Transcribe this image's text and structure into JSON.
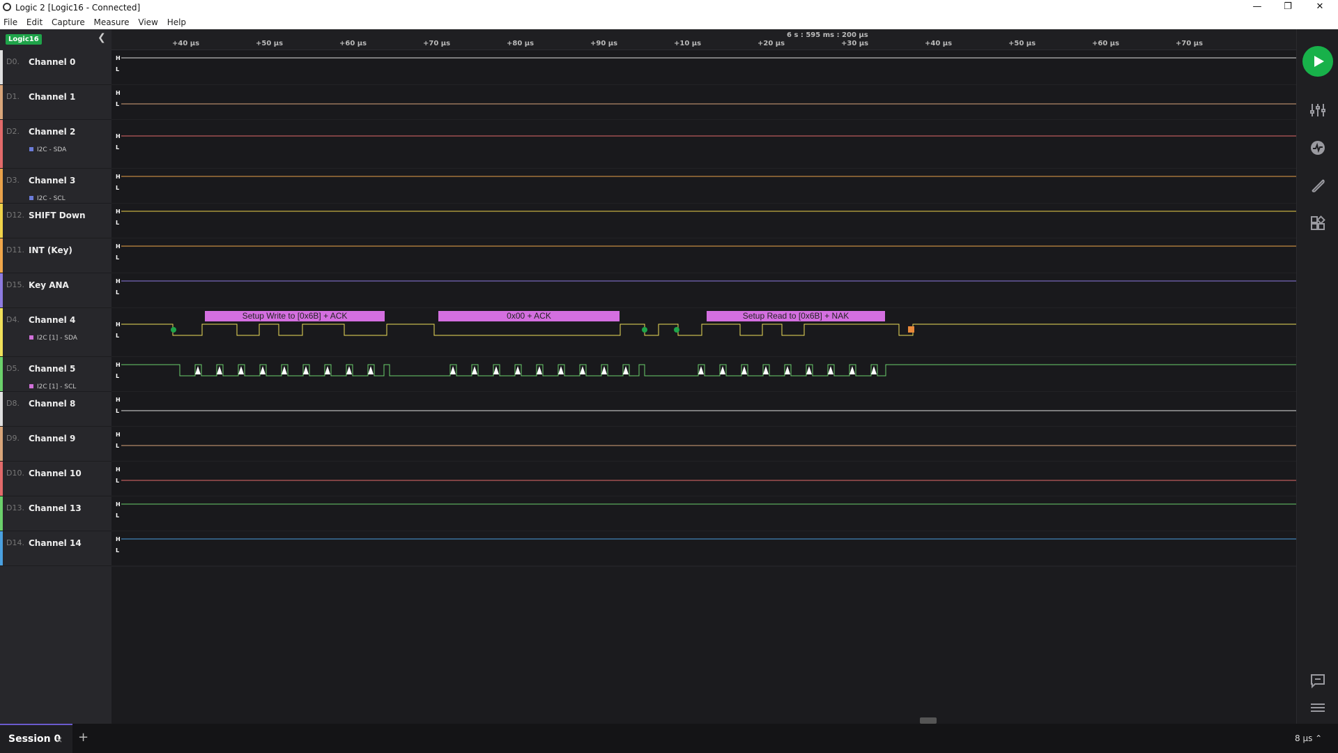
{
  "window": {
    "title": "Logic 2 [Logic16 - Connected]",
    "minimize": "—",
    "restore": "❐",
    "close": "✕"
  },
  "menu": [
    "File",
    "Edit",
    "Capture",
    "Measure",
    "View",
    "Help"
  ],
  "device_badge": "Logic16",
  "ruler": {
    "center": "6 s : 595 ms : 200 µs",
    "ticks": [
      "+40 µs",
      "+50 µs",
      "+60 µs",
      "+70 µs",
      "+80 µs",
      "+90 µs",
      "+10 µs",
      "+20 µs",
      "+30 µs",
      "+40 µs",
      "+50 µs",
      "+60 µs",
      "+70 µs"
    ]
  },
  "channels": [
    {
      "num": "D0.",
      "name": "Channel 0",
      "color": "#e0e0e0",
      "level": "high",
      "sub": ""
    },
    {
      "num": "D1.",
      "name": "Channel 1",
      "color": "#d9a57a",
      "level": "low",
      "sub": ""
    },
    {
      "num": "D2.",
      "name": "Channel 2",
      "color": "#e26a6a",
      "level": "high",
      "sub": "I2C - SDA",
      "sub_color": "#6b7bd8"
    },
    {
      "num": "D3.",
      "name": "Channel 3",
      "color": "#e8a14a",
      "level": "high",
      "sub": "I2C - SCL",
      "sub_color": "#6b7bd8"
    },
    {
      "num": "D12.",
      "name": "SHIFT Down",
      "color": "#f0d34a",
      "level": "high",
      "sub": ""
    },
    {
      "num": "D11.",
      "name": "INT (Key)",
      "color": "#f0a64a",
      "level": "high",
      "sub": ""
    },
    {
      "num": "D15.",
      "name": "Key ANA",
      "color": "#8d7be0",
      "level": "high",
      "sub": ""
    },
    {
      "num": "D4.",
      "name": "Channel 4",
      "color": "#f0e05a",
      "level": "data",
      "sub": "I2C [1] - SDA",
      "sub_color": "#d070d8"
    },
    {
      "num": "D5.",
      "name": "Channel 5",
      "color": "#6bd06b",
      "level": "clock",
      "sub": "I2C [1] - SCL",
      "sub_color": "#d070d8"
    },
    {
      "num": "D8.",
      "name": "Channel 8",
      "color": "#e0e0e0",
      "level": "low",
      "sub": ""
    },
    {
      "num": "D9.",
      "name": "Channel 9",
      "color": "#d9a57a",
      "level": "low",
      "sub": ""
    },
    {
      "num": "D10.",
      "name": "Channel 10",
      "color": "#e26a6a",
      "level": "low",
      "sub": ""
    },
    {
      "num": "D13.",
      "name": "Channel 13",
      "color": "#6bd06b",
      "level": "high",
      "sub": ""
    },
    {
      "num": "D14.",
      "name": "Channel 14",
      "color": "#4aa0e0",
      "level": "high",
      "sub": ""
    }
  ],
  "level_labels": {
    "high": "H",
    "low": "L"
  },
  "i2c_frames": [
    "Setup Write to [0x6B] + ACK",
    "0x00 + ACK",
    "Setup Read to [0x6B] + NAK"
  ],
  "session": {
    "tab": "Session 0",
    "close": "×",
    "add": "+"
  },
  "zoom_level": "8 µs ⌃",
  "icons": [
    "play-icon",
    "analyzers-icon",
    "measure-icon",
    "timing-marker-icon",
    "extensions-icon",
    "comment-icon",
    "menu-icon"
  ]
}
